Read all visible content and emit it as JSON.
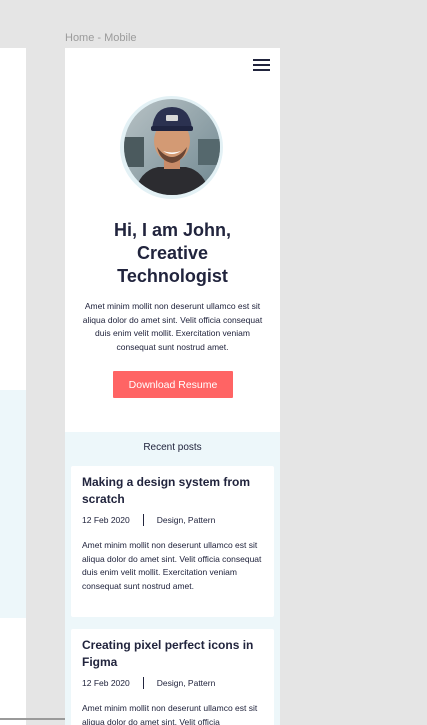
{
  "frame_label": "Home - Mobile",
  "nav": {
    "menu_icon": "hamburger-menu-icon"
  },
  "hero": {
    "title_line1": "Hi, I am John,",
    "title_line2": "Creative",
    "title_line3": "Technologist",
    "intro": "Amet minim mollit non deserunt ullamco est sit aliqua dolor do amet sint. Velit officia consequat duis enim velit mollit. Exercitation veniam consequat sunt nostrud amet.",
    "button_label": "Download Resume",
    "avatar_alt": "profile-photo"
  },
  "recent_posts": {
    "heading": "Recent posts",
    "posts": [
      {
        "title": "Making a design system from scratch",
        "date": "12 Feb 2020",
        "tags": "Design, Pattern",
        "excerpt": "Amet minim mollit non deserunt ullamco est sit aliqua dolor do amet sint. Velit officia consequat duis enim velit mollit. Exercitation veniam consequat sunt nostrud amet."
      },
      {
        "title": "Creating pixel perfect icons in Figma",
        "date": "12 Feb 2020",
        "tags": "Design, Pattern",
        "excerpt": "Amet minim mollit non deserunt ullamco est sit aliqua dolor do amet sint. Velit officia"
      }
    ]
  },
  "colors": {
    "canvas": "#e5e5e5",
    "text": "#21243d",
    "accent": "#ff6464",
    "section_bg": "#edf7fa",
    "avatar_ring": "#e3f1f5"
  }
}
